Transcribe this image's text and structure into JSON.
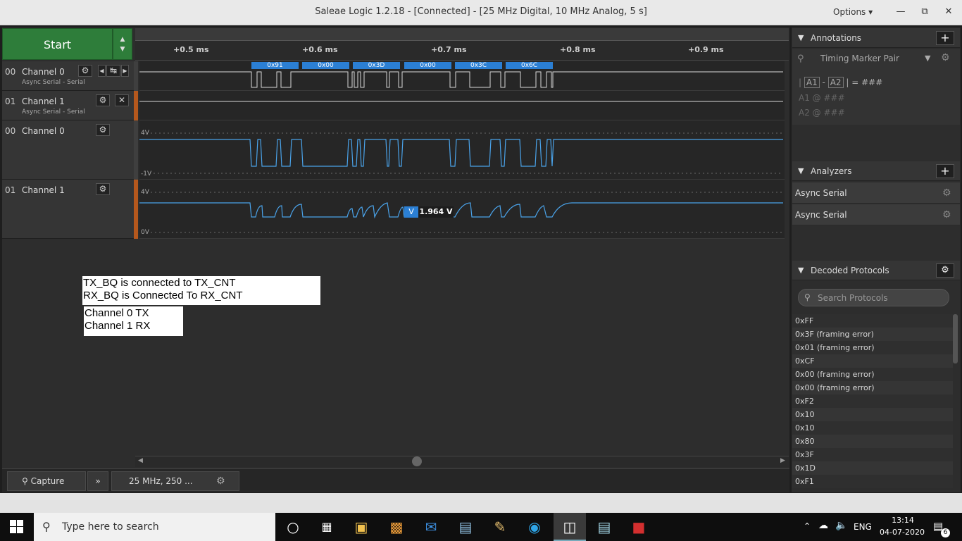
{
  "window": {
    "title": "Saleae Logic 1.2.18 - [Connected] - [25 MHz Digital, 10 MHz Analog, 5 s]",
    "options_label": "Options",
    "minimize": "—",
    "maximize": "⧉",
    "close": "✕"
  },
  "toolbar": {
    "start_label": "Start"
  },
  "ruler": {
    "ticks": [
      "+0.5 ms",
      "+0.6 ms",
      "+0.7 ms",
      "+0.8 ms",
      "+0.9 ms"
    ]
  },
  "channels": [
    {
      "num": "00",
      "name": "Channel 0",
      "sub": "Async Serial - Serial"
    },
    {
      "num": "01",
      "name": "Channel 1",
      "sub": "Async Serial - Serial"
    },
    {
      "num": "00",
      "name": "Channel 0",
      "sub": ""
    },
    {
      "num": "01",
      "name": "Channel 1",
      "sub": ""
    }
  ],
  "decoded_bubbles": [
    "0x91",
    "0x00",
    "0x3D",
    "0x00",
    "0x3C",
    "0x6C"
  ],
  "analog": {
    "ch0_top": "4V",
    "ch0_bottom": "-1V",
    "ch1_top": "4V",
    "ch1_bottom": "0V",
    "measure_symbol": "V",
    "measure_value": "1.964 V"
  },
  "notes": {
    "note1_line1": "TX_BQ is connected to TX_CNT",
    "note1_line2": "RX_BQ is Connected To RX_CNT",
    "note2_line1": "Channel 0 TX",
    "note2_line2": "Channel 1 RX"
  },
  "bottom": {
    "capture_label": "Capture",
    "rate_label": "25 MHz, 250 ..."
  },
  "annotations": {
    "header": "Annotations",
    "marker_pair": "Timing Marker Pair",
    "row1_a1": "A1",
    "row1_dash": "-",
    "row1_a2": "A2",
    "row1_eq": "| = ###",
    "row2": "A1 @ ###",
    "row3": "A2 @ ###"
  },
  "analyzers": {
    "header": "Analyzers",
    "items": [
      "Async Serial",
      "Async Serial"
    ]
  },
  "decoded": {
    "header": "Decoded Protocols",
    "search_placeholder": "Search Protocols",
    "items": [
      "0xFF",
      "0x3F (framing error)",
      "0x01 (framing error)",
      "0xCF",
      "0x00 (framing error)",
      "0x00 (framing error)",
      "0xF2",
      "0x10",
      "0x10",
      "0x80",
      "0x3F",
      "0x1D",
      "0xF1"
    ]
  },
  "taskbar": {
    "search_placeholder": "Type here to search",
    "lang": "ENG",
    "time": "13:14",
    "date": "04-07-2020",
    "notif_count": "6"
  }
}
